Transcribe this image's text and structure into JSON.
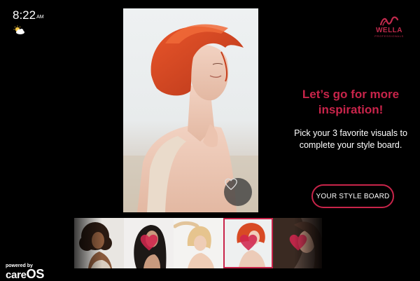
{
  "status": {
    "time": "8:22",
    "ampm": "AM",
    "weather_icon": "partly-cloudy-icon"
  },
  "brand": {
    "name": "WELLA",
    "sub": "PROFESSIONALS",
    "color": "#c22a4d"
  },
  "hero": {
    "favorite_icon": "heart-outline-icon"
  },
  "panel": {
    "headline": "Let’s go for more inspiration!",
    "description": "Pick your 3 favorite visuals to complete your style board.",
    "cta_label": "YOUR STYLE BOARD",
    "accent": "#c8244a"
  },
  "thumbnails": [
    {
      "id": "curly-dark-hair",
      "favorited": false,
      "selected": false
    },
    {
      "id": "long-dark-hair",
      "favorited": true,
      "selected": false
    },
    {
      "id": "blonde-bob",
      "favorited": false,
      "selected": false
    },
    {
      "id": "red-bob",
      "favorited": true,
      "selected": true
    },
    {
      "id": "brown-waves",
      "favorited": true,
      "selected": false
    }
  ],
  "footer": {
    "powered_by": "powered by",
    "care": "care",
    "os": "OS"
  }
}
